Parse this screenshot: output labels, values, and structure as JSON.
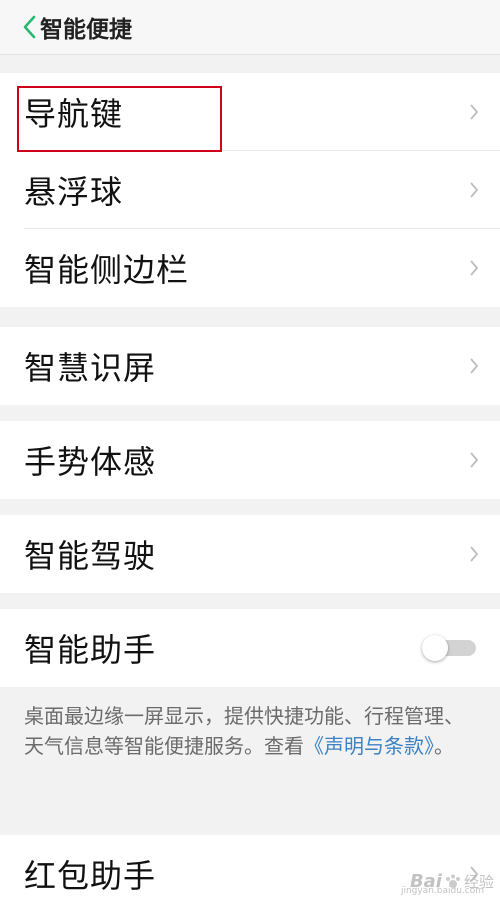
{
  "header": {
    "title": "智能便捷"
  },
  "groups": [
    {
      "items": [
        {
          "label": "导航键"
        },
        {
          "label": "悬浮球"
        },
        {
          "label": "智能侧边栏"
        }
      ]
    },
    {
      "items": [
        {
          "label": "智慧识屏"
        }
      ]
    },
    {
      "items": [
        {
          "label": "手势体感"
        }
      ]
    },
    {
      "items": [
        {
          "label": "智能驾驶"
        }
      ]
    },
    {
      "items": [
        {
          "label": "智能助手",
          "toggle": false
        }
      ]
    },
    {
      "items": [
        {
          "label": "红包助手"
        }
      ]
    }
  ],
  "assistant_desc": {
    "text": "桌面最边缘一屏显示，提供快捷功能、行程管理、天气信息等智能便捷服务。查看",
    "link": "《声明与条款》",
    "suffix": "。"
  },
  "watermark": {
    "brand": "Bai",
    "suffix": "经验",
    "sub": "jingyan.baidu.com"
  },
  "colors": {
    "accent_green": "#2bb673",
    "link_blue": "#3b82c4",
    "highlight_red": "#d0021b"
  }
}
